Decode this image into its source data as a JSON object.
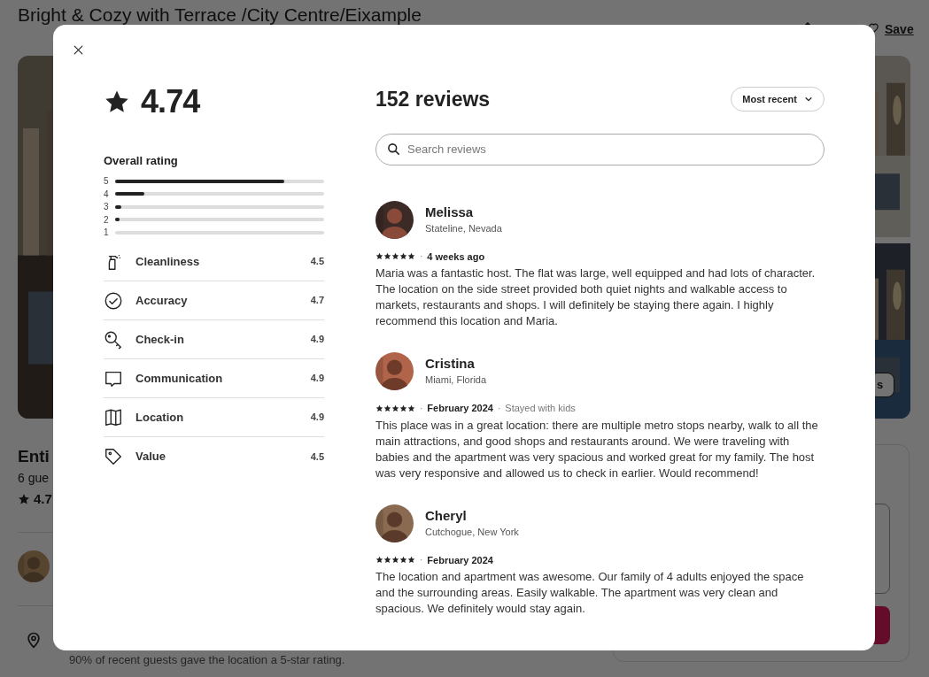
{
  "background_page": {
    "title": "Bright & Cozy with Terrace /City Centre/Eixample",
    "save_link": "Save",
    "listing_heading": "Enti",
    "guests": "6 gue",
    "rating": "4.7",
    "photos_button": "s",
    "location_note": "90% of recent guests gave the location a 5-star rating."
  },
  "modal": {
    "overall_score": "4.74",
    "overall_label": "Overall rating",
    "distribution": [
      {
        "label": "5",
        "level": 0.81
      },
      {
        "label": "4",
        "level": 0.14
      },
      {
        "label": "3",
        "level": 0.03
      },
      {
        "label": "2",
        "level": 0.02
      },
      {
        "label": "1",
        "level": 0
      }
    ],
    "categories": [
      {
        "kind": "cleanliness",
        "label": "Cleanliness",
        "score": "4.5"
      },
      {
        "kind": "accuracy",
        "label": "Accuracy",
        "score": "4.7"
      },
      {
        "kind": "checkin",
        "label": "Check-in",
        "score": "4.9"
      },
      {
        "kind": "communication",
        "label": "Communication",
        "score": "4.9"
      },
      {
        "kind": "location",
        "label": "Location",
        "score": "4.9"
      },
      {
        "kind": "value",
        "label": "Value",
        "score": "4.5"
      }
    ],
    "reviews_title": "152 reviews",
    "sort": "Most recent",
    "search": {
      "placeholder": "Search reviews"
    },
    "reviews": [
      {
        "name": "Melissa",
        "location": "Stateline, Nevada",
        "stars": 5,
        "separator": "·",
        "date": "4 weeks ago",
        "text": "Maria was a fantastic host. The flat was large, well equipped and had lots of character. The location on the side street provided both quiet nights and walkable access to markets, restaurants and shops. I will definitely be staying there again. I highly recommend this location and Maria."
      },
      {
        "name": "Cristina",
        "location": "Miami, Florida",
        "stars": 5,
        "separator": "·",
        "date": "February 2024",
        "note_separator": "·",
        "note": "Stayed with kids",
        "text": "This place was in a great location: there are multiple metro stops nearby, walk to all the main attractions, and good shops and restaurants around. We were traveling with babies and the apartment was very spacious and worked great for my family. The host was very responsive and allowed us to check in earlier. Would recommend!"
      },
      {
        "name": "Cheryl",
        "location": "Cutchogue, New York",
        "stars": 5,
        "separator": "·",
        "date": "February 2024",
        "text": "The location and apartment was awesome. Our family of 4 adults enjoyed the space and the surrounding areas. Easily walkable. The apartment was very clean and spacious. We definitely would stay again."
      }
    ]
  }
}
